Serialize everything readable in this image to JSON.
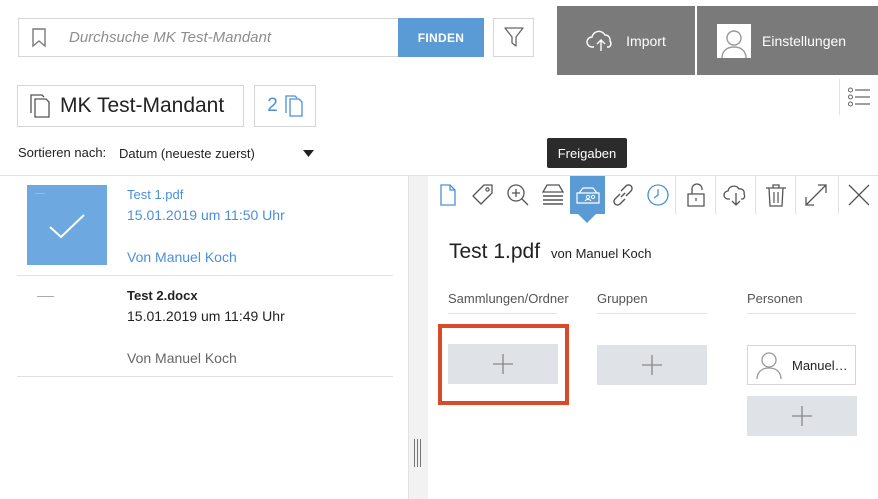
{
  "search": {
    "placeholder": "Durchsuche MK Test-Mandant",
    "find_label": "FINDEN"
  },
  "header": {
    "import_label": "Import",
    "settings_label": "Einstellungen"
  },
  "client": {
    "name": "MK Test-Mandant",
    "document_count": "2"
  },
  "sort": {
    "label": "Sortieren nach:",
    "value": "Datum (neueste zuerst)"
  },
  "documents": [
    {
      "name": "Test 1.pdf",
      "date": "15.01.2019 um 11:50 Uhr",
      "author": "Von Manuel Koch"
    },
    {
      "name": "Test 2.docx",
      "date": "15.01.2019 um 11:49 Uhr",
      "author": "Von Manuel Koch"
    }
  ],
  "toolbar": {
    "tooltip": "Freigaben",
    "active_tab": "shares",
    "icons": [
      "document-icon",
      "tag-icon",
      "zoom-in-icon",
      "stack-icon",
      "shares-icon",
      "link-icon",
      "clock-icon",
      "unlock-icon",
      "cloud-download-icon",
      "trash-icon",
      "expand-icon",
      "close-icon"
    ]
  },
  "detail": {
    "title": "Test 1.pdf",
    "by": "von Manuel Koch",
    "columns": {
      "collections": "Sammlungen/Ordner",
      "groups": "Gruppen",
      "persons": "Personen"
    },
    "person": "Manuel Koch"
  },
  "colors": {
    "accent": "#5b9bd5",
    "header_button": "#7a7a7a",
    "highlight": "#d94a2a",
    "add_button": "#dfe2e6"
  }
}
